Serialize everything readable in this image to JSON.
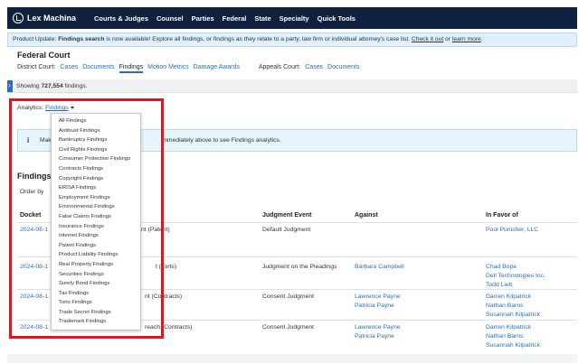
{
  "nav": {
    "brand": "Lex Machina",
    "items": [
      "Courts & Judges",
      "Counsel",
      "Parties",
      "Federal",
      "State",
      "Specialty",
      "Quick Tools"
    ]
  },
  "banner": {
    "bold": "Product Update:",
    "prefix": "Product Update: ",
    "feature": "Findings search",
    "text": " is now available! Explore all findings, or findings as they relate to a party, law firm or individual attorney's case list. ",
    "link1": "Check it out",
    "or": " or ",
    "link2": "learn more",
    "end": "."
  },
  "court": {
    "title": "Federal Court",
    "district_label": "District Court:",
    "district_tabs": [
      "Cases",
      "Documents",
      "Findings",
      "Motion Metrics",
      "Damage Awards"
    ],
    "appeals_label": "Appeals Court:",
    "appeals_tabs": [
      "Cases",
      "Documents"
    ]
  },
  "count": {
    "prefix": "Showing ",
    "value": "727,554",
    "suffix": " findings."
  },
  "analytics": {
    "label": "Analytics:",
    "selected": "Findings"
  },
  "info": {
    "icon": "i",
    "text_left": "Mak",
    "text_right": "immediately above to see Findings analytics."
  },
  "findings": {
    "title": "Findings",
    "order_by": "Order by"
  },
  "table": {
    "headers": [
      "Docket",
      "Judgment Event",
      "Against",
      "In Favor of"
    ],
    "rows": [
      {
        "docket": "2024-08-1",
        "finding": "nt (Patent)",
        "event": "Default Judgment",
        "against": [],
        "favor": [
          "Pool Punisher, LLC"
        ]
      },
      {
        "docket": "2024-08-1",
        "finding": "t (Torts)",
        "event": "Judgment on the Pleadings",
        "against": [
          "Barbara Campbell"
        ],
        "favor": [
          "Chad Bope",
          "Dell Technologies Inc.",
          "Todd Lieb"
        ]
      },
      {
        "docket": "2024-08-1",
        "finding": "nt (Contracts)",
        "event": "Consent Judgment",
        "against": [
          "Lawrence Payne",
          "Patricia Payne"
        ],
        "favor": [
          "Darren Kilpatrick",
          "Nathan Barns",
          "Susannah Kilpatrick"
        ]
      },
      {
        "docket": "2024-08-1",
        "finding": "reach (Contracts)",
        "event": "Consent Judgment",
        "against": [
          "Lawrence Payne",
          "Patricia Payne"
        ],
        "favor": [
          "Darren Kilpatrick",
          "Nathan Barns",
          "Susannah Kilpatrick"
        ]
      }
    ]
  },
  "dropdown": {
    "options": [
      "All Findings",
      "Antitrust Findings",
      "Bankruptcy Findings",
      "Civil Rights Findings",
      "Consumer Protection Findings",
      "Contracts Findings",
      "Copyright Findings",
      "ERISA Findings",
      "Employment Findings",
      "Environmental Findings",
      "False Claims Findings",
      "Insurance Findings",
      "Internet Findings",
      "Patent Findings",
      "Product Liability Findings",
      "Real Property Findings",
      "Securities Findings",
      "Surety Bond Findings",
      "Tax Findings",
      "Torts Findings",
      "Trade Secret Findings",
      "Trademark Findings"
    ]
  },
  "colors": {
    "nav_bg": "#10213f",
    "link": "#2a6ebb",
    "highlight_border": "#e0161d",
    "banner_bg": "#dff0fa"
  }
}
